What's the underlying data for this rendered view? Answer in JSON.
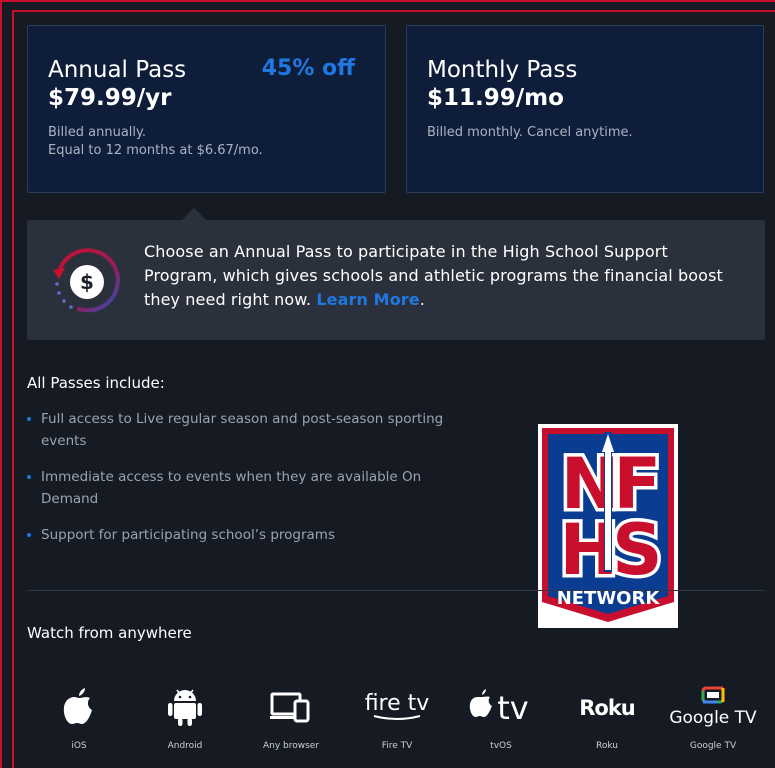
{
  "plans": {
    "annual": {
      "title": "Annual Pass",
      "price": "$79.99/yr",
      "discount": "45% off",
      "note_line1": "Billed annually.",
      "note_line2": "Equal to 12 months at $6.67/mo."
    },
    "monthly": {
      "title": "Monthly Pass",
      "price": "$11.99/mo",
      "note_line1": "Billed monthly. Cancel anytime."
    }
  },
  "promo": {
    "text": "Choose an Annual Pass to participate in the High School Support Program, which gives schools and athletic programs the financial boost they need right now. ",
    "link": "Learn More",
    "suffix": "."
  },
  "includes": {
    "title": "All Passes include:",
    "items": [
      "Full access to Live regular season and post-season sporting events",
      "Immediate access to events when they are available On Demand",
      "Support for participating school’s programs"
    ]
  },
  "logo": {
    "top": "NF",
    "middle": "HS",
    "bottom": "NETWORK"
  },
  "watch": {
    "title": "Watch from anywhere",
    "devices": [
      {
        "label": "iOS",
        "icon": "apple-icon"
      },
      {
        "label": "Android",
        "icon": "android-icon"
      },
      {
        "label": "Any browser",
        "icon": "browser-devices-icon"
      },
      {
        "label": "Fire TV",
        "icon": "fire-tv-icon",
        "mark": "fire tv"
      },
      {
        "label": "tvOS",
        "icon": "apple-tv-icon",
        "mark": "tv"
      },
      {
        "label": "Roku",
        "icon": "roku-icon",
        "mark": "Roku"
      },
      {
        "label": "Google TV",
        "icon": "google-tv-icon",
        "mark": "Google TV"
      }
    ]
  },
  "colors": {
    "accent": "#1e78e0",
    "card_bg": "#0e1e3a",
    "page_bg": "#161a23",
    "promo_bg": "#2b313c",
    "brand_red": "#c8102e"
  }
}
